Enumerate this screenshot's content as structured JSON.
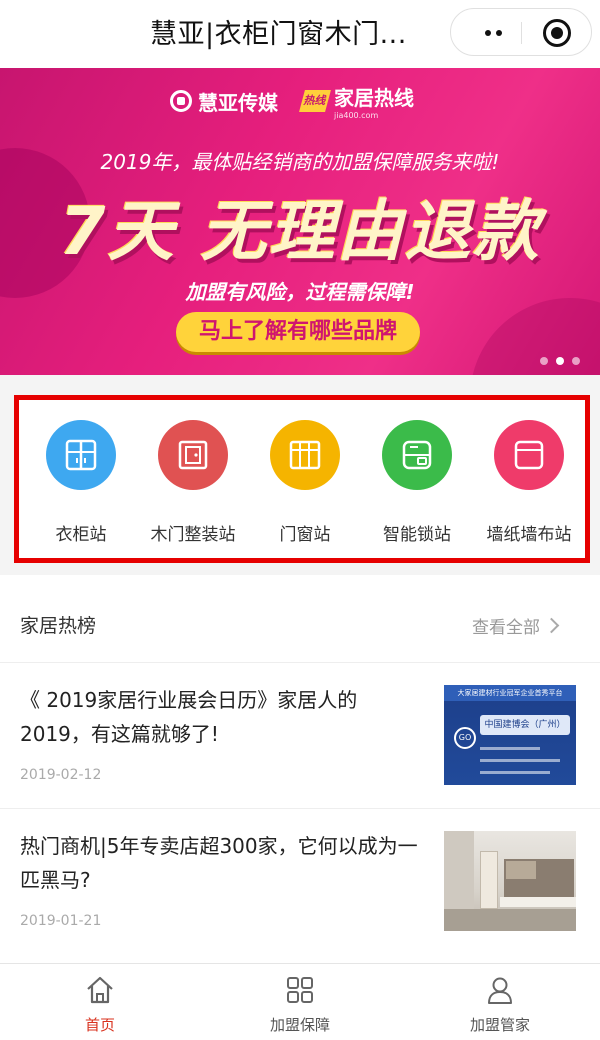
{
  "header": {
    "title": "慧亚|衣柜门窗木门...",
    "more_icon": "more-dots-icon",
    "close_icon": "target-circle-icon"
  },
  "banner": {
    "brand1": "慧亚传媒",
    "brand2": "家居热线",
    "brand2_badge": "热线",
    "brand2_sub": "jia400.com",
    "headline": "2019年，最体贴经销商的加盟保障服务来啦!",
    "big_text": "7天 无理由退款",
    "subline": "加盟有风险，过程需保障!",
    "cta": "马上了解有哪些品牌",
    "slide_count": 3,
    "active_slide": 2,
    "colors": {
      "bg": "#e61f7d",
      "cta_bg": "#ffd33a"
    }
  },
  "categories": [
    {
      "label": "衣柜站",
      "icon": "wardrobe-icon",
      "color": "#3ea8f0"
    },
    {
      "label": "木门整装站",
      "icon": "door-icon",
      "color": "#e05252"
    },
    {
      "label": "门窗站",
      "icon": "window-icon",
      "color": "#f5b400"
    },
    {
      "label": "智能锁站",
      "icon": "smart-lock-icon",
      "color": "#3bbb4a"
    },
    {
      "label": "墙纸墙布站",
      "icon": "wallpaper-icon",
      "color": "#ef3b6a"
    }
  ],
  "hot": {
    "title": "家居热榜",
    "view_all": "查看全部",
    "articles": [
      {
        "title": "《 2019家居行业展会日历》家居人的2019，有这篇就够了!",
        "date": "2019-02-12",
        "thumb": {
          "bar": "大家居建材行业冠军企业首秀平台",
          "logo": "GO",
          "label": "中国建博会（广州）"
        }
      },
      {
        "title": "热门商机|5年专卖店超300家，它何以成为一匹黑马?",
        "date": "2019-01-21"
      }
    ]
  },
  "tabbar": {
    "items": [
      {
        "label": "首页",
        "icon": "home-icon",
        "active": true
      },
      {
        "label": "加盟保障",
        "icon": "grid-icon",
        "active": false
      },
      {
        "label": "加盟管家",
        "icon": "user-icon",
        "active": false
      }
    ],
    "active_color": "#d9321e"
  }
}
